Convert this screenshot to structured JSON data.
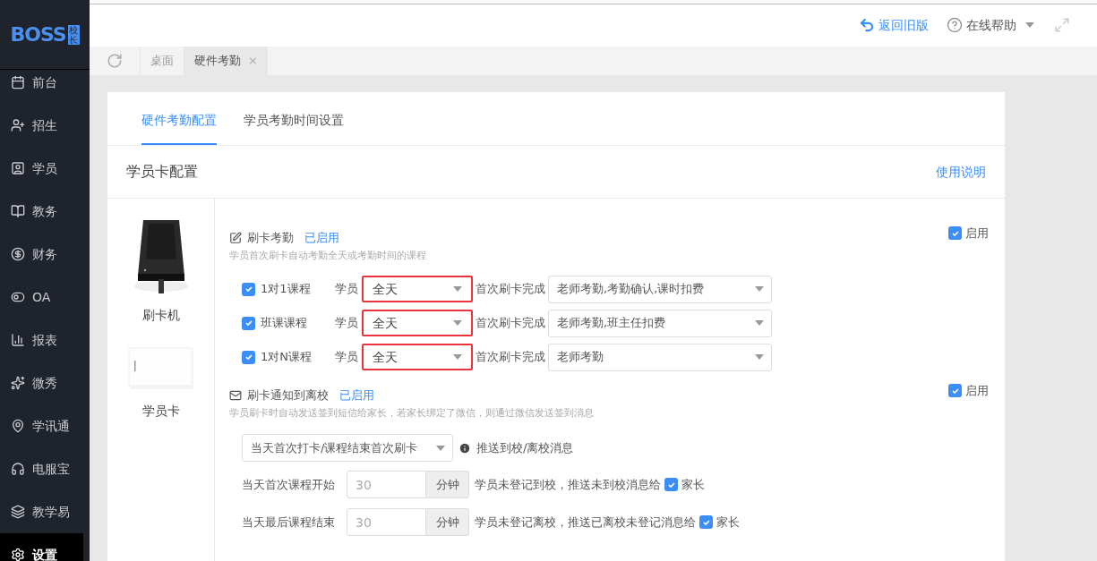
{
  "logo": {
    "text": "BOSS",
    "badge": "校长"
  },
  "topbar": {
    "back_link": "返回旧版",
    "help": "在线帮助"
  },
  "page_tabs": [
    {
      "label": "桌面",
      "selected": false
    },
    {
      "label": "硬件考勤",
      "selected": true,
      "close": "×"
    }
  ],
  "sidebar": {
    "items": [
      {
        "label": "前台",
        "selected": false
      },
      {
        "label": "招生",
        "selected": false
      },
      {
        "label": "学员",
        "selected": false
      },
      {
        "label": "教务",
        "selected": false
      },
      {
        "label": "财务",
        "selected": false
      },
      {
        "label": "OA",
        "selected": false
      },
      {
        "label": "报表",
        "selected": false
      },
      {
        "label": "微秀",
        "selected": false
      },
      {
        "label": "学讯通",
        "selected": false
      },
      {
        "label": "电服宝",
        "selected": false
      },
      {
        "label": "教学易",
        "selected": false
      },
      {
        "label": "设置",
        "selected": true
      }
    ]
  },
  "tabs": [
    {
      "label": "硬件考勤配置",
      "selected": true
    },
    {
      "label": "学员考勤时间设置",
      "selected": false
    }
  ],
  "section": {
    "title": "学员卡配置",
    "help_link": "使用说明"
  },
  "devices": [
    {
      "label": "刷卡机",
      "kind": "reader"
    },
    {
      "label": "学员卡",
      "kind": "card"
    }
  ],
  "swipe_attendance": {
    "title": "刷卡考勤",
    "status": "已启用",
    "description": "学员首次刷卡自动考勤全天或考勤时间的课程",
    "enable": {
      "label": "启用",
      "checked": true
    },
    "rows": [
      {
        "label": "1对1课程",
        "checked": true,
        "student_label": "学员",
        "period": "全天",
        "highlighted": true,
        "action_label": "首次刷卡完成",
        "action": "老师考勤,考勤确认,课时扣费"
      },
      {
        "label": "班课课程",
        "checked": true,
        "student_label": "学员",
        "period": "全天",
        "highlighted": true,
        "action_label": "首次刷卡完成",
        "action": "老师考勤,班主任扣费"
      },
      {
        "label": "1对N课程",
        "checked": true,
        "student_label": "学员",
        "period": "全天",
        "highlighted": true,
        "action_label": "首次刷卡完成",
        "action": "老师考勤"
      }
    ]
  },
  "notify": {
    "title": "刷卡通知到离校",
    "status": "已启用",
    "description": "学员刷卡时自动发送签到短信给家长，若家长绑定了微信，则通过微信发送签到消息",
    "enable": {
      "label": "启用",
      "checked": true
    },
    "trigger": "当天首次打卡/课程结束首次刷卡",
    "trigger_note": "推送到校/离校消息",
    "rows": [
      {
        "label": "当天首次课程开始",
        "minutes": "30",
        "unit": "分钟",
        "message": "学员未登记到校，推送未到校消息给",
        "parent_checked": true,
        "parent_label": "家长"
      },
      {
        "label": "当天最后课程结束",
        "minutes": "30",
        "unit": "分钟",
        "message": "学员未登记离校，推送已离校未登记消息给",
        "parent_checked": true,
        "parent_label": "家长"
      }
    ]
  }
}
